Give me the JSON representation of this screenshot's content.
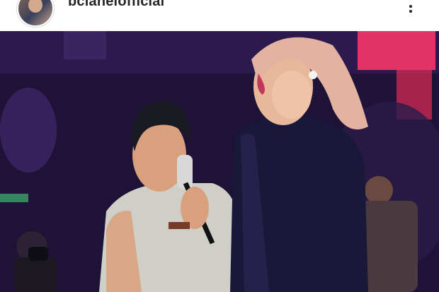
{
  "post": {
    "username": "bclaneiofficial",
    "avatar_icon": "profile-avatar-icon",
    "more_icon": "more-options-icon"
  },
  "photo": {
    "description_icon": "concert-photo"
  },
  "colors": {
    "stage_purple": "#2a1845",
    "neon_pink": "#ff3a6a",
    "jacket_navy": "#1a1a3a"
  }
}
